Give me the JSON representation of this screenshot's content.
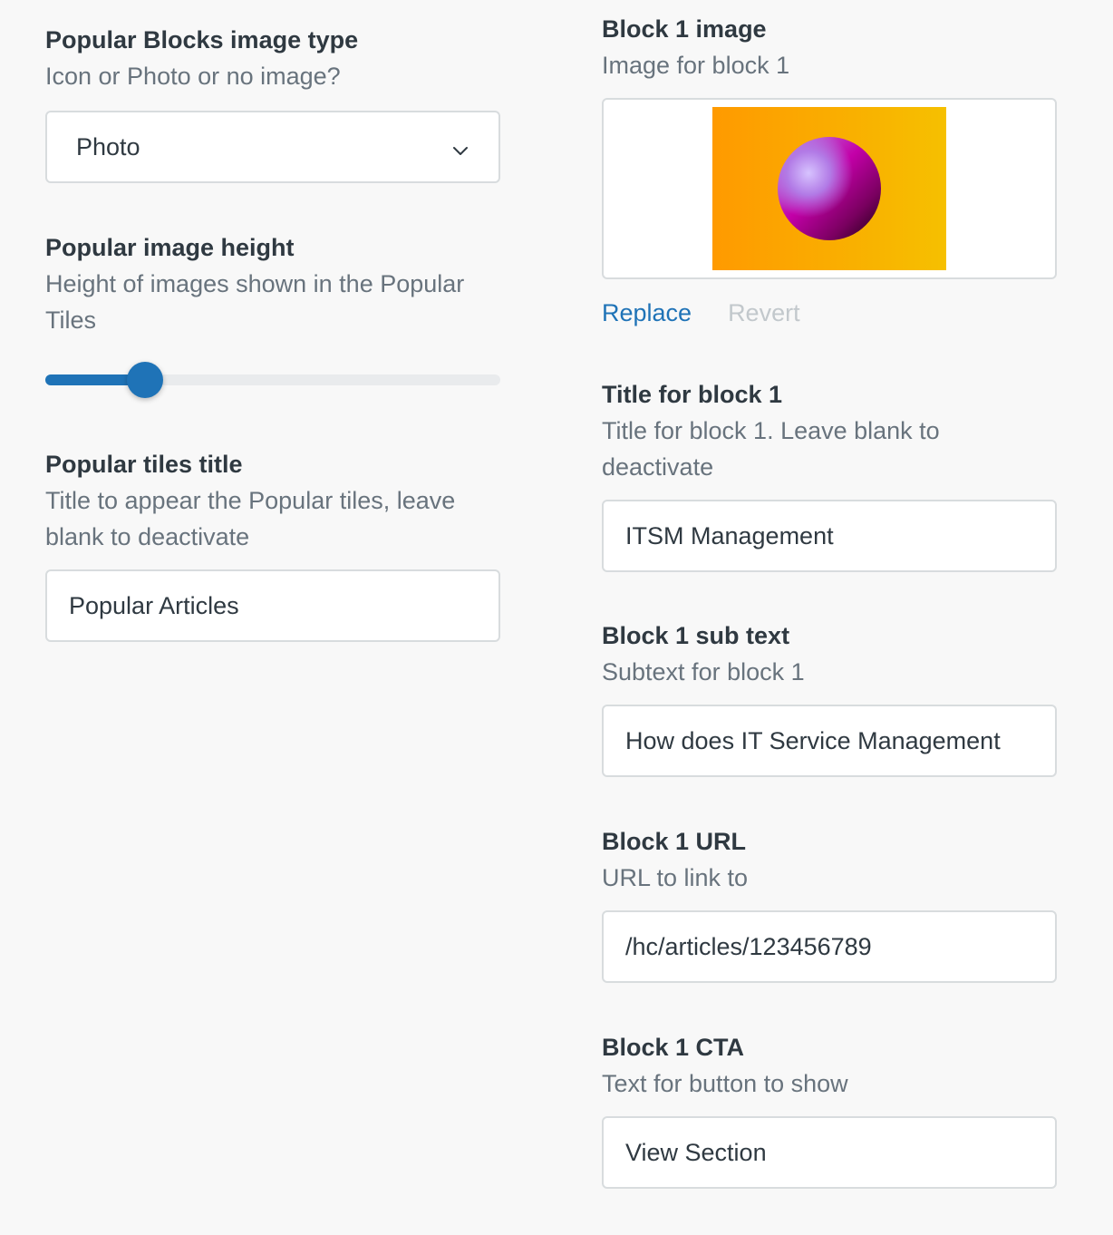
{
  "left": {
    "image_type": {
      "label": "Popular Blocks image type",
      "hint": "Icon or Photo or no image?",
      "selected": "Photo"
    },
    "image_height": {
      "label": "Popular image height",
      "hint": "Height of images shown in the Popular Tiles",
      "slider_fraction": 0.22
    },
    "tiles_title": {
      "label": "Popular tiles title",
      "hint": "Title to appear the Popular tiles, leave blank to deactivate",
      "value": "Popular Articles"
    }
  },
  "right": {
    "block_image": {
      "label": "Block 1 image",
      "hint": "Image for block 1",
      "replace_label": "Replace",
      "revert_label": "Revert"
    },
    "block_title": {
      "label": "Title for block 1",
      "hint": "Title for block 1. Leave blank to deactivate",
      "value": "ITSM Management"
    },
    "block_subtext": {
      "label": "Block 1 sub text",
      "hint": "Subtext for block 1",
      "value": "How does IT Service Management"
    },
    "block_url": {
      "label": "Block 1 URL",
      "hint": "URL to link to",
      "value": "/hc/articles/123456789"
    },
    "block_cta": {
      "label": "Block 1 CTA",
      "hint": "Text for button to show",
      "value": "View Section"
    }
  },
  "colors": {
    "accent": "#1f73b7",
    "label": "#2f3941",
    "hint": "#68737d",
    "disabled_link": "#c2c8cc",
    "border": "#d8dcde",
    "background": "#f8f8f8"
  }
}
